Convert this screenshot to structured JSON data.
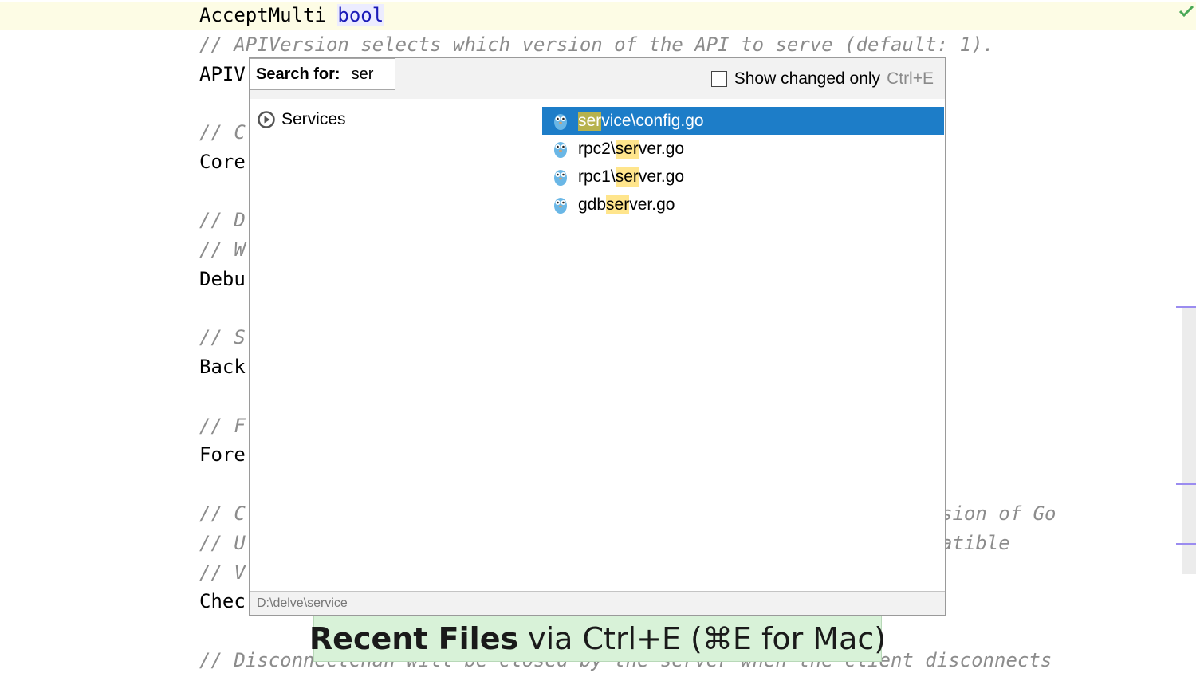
{
  "editor": {
    "line1": {
      "name": "AcceptMulti ",
      "type": "bool"
    },
    "line2": "// APIVersion selects which version of the API to serve (default: 1).",
    "line3": "APIV",
    "line4": "// C",
    "line5": "Core",
    "line6": "// D",
    "line7": "// W",
    "line8": "Debu",
    "line9": "// S",
    "line10": "Back",
    "line11": "// F",
    "line12": "Fore",
    "line13": "// C",
    "line13_tail": "sion of Go",
    "line14": "// U",
    "line14_tail": "atible",
    "line15": "// V",
    "line16": "Chec",
    "line17": "// DisconnectChan will be closed by the server when the client disconnects"
  },
  "popup": {
    "search_label": "Search for:",
    "search_value": "ser",
    "changed_only_label": "Show changed only",
    "changed_only_shortcut": "Ctrl+E",
    "groups": [
      {
        "label": "Services",
        "icon": "services-play-icon"
      }
    ],
    "files": [
      {
        "pre": "",
        "hl": "ser",
        "post": "vice\\config.go",
        "selected": true
      },
      {
        "pre": "rpc2\\",
        "hl": "ser",
        "post": "ver.go",
        "selected": false
      },
      {
        "pre": "rpc1\\",
        "hl": "ser",
        "post": "ver.go",
        "selected": false
      },
      {
        "pre": "gdb",
        "hl": "ser",
        "post": "ver.go",
        "selected": false
      }
    ],
    "status_path": "D:\\delve\\service"
  },
  "caption": {
    "bold": "Recent Files",
    "rest": "via Ctrl+E (⌘E for Mac)"
  },
  "colors": {
    "selection": "#1d7dc8",
    "highlight": "#ffe58c",
    "caption_bg": "#d8f2d8"
  }
}
